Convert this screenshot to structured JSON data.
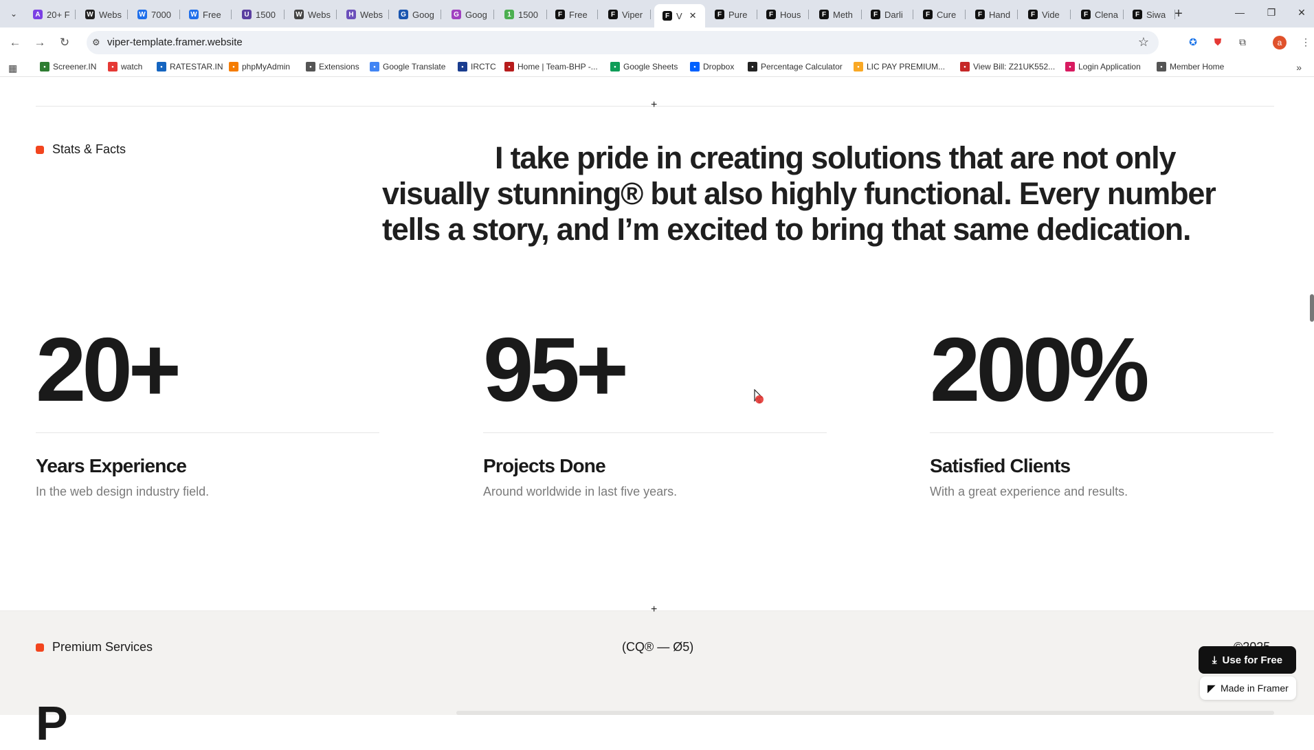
{
  "browser": {
    "tabs": [
      {
        "label": "20+ F",
        "color": "#7b3fe4",
        "glyph": "A"
      },
      {
        "label": "Webs",
        "color": "#222222",
        "glyph": "W"
      },
      {
        "label": "7000",
        "color": "#1f6feb",
        "glyph": "W"
      },
      {
        "label": "Free",
        "color": "#1f6feb",
        "glyph": "W"
      },
      {
        "label": "1500",
        "color": "#5b3fa0",
        "glyph": "U"
      },
      {
        "label": "Webs",
        "color": "#444444",
        "glyph": "W"
      },
      {
        "label": "Webs",
        "color": "#6b4fbb",
        "glyph": "H"
      },
      {
        "label": "Goog",
        "color": "#1a56b0",
        "glyph": "G"
      },
      {
        "label": "Goog",
        "color": "#a040c0",
        "glyph": "G"
      },
      {
        "label": "1500",
        "color": "#4caf50",
        "glyph": "1"
      },
      {
        "label": "Free",
        "color": "#111111",
        "glyph": "F"
      },
      {
        "label": "Viper",
        "color": "#111111",
        "glyph": "F"
      },
      {
        "label": "V",
        "color": "#111111",
        "glyph": "F"
      },
      {
        "label": "Pure",
        "color": "#111111",
        "glyph": "F"
      },
      {
        "label": "Hous",
        "color": "#111111",
        "glyph": "F"
      },
      {
        "label": "Meth",
        "color": "#111111",
        "glyph": "F"
      },
      {
        "label": "Darli",
        "color": "#111111",
        "glyph": "F"
      },
      {
        "label": "Cure",
        "color": "#111111",
        "glyph": "F"
      },
      {
        "label": "Hand",
        "color": "#111111",
        "glyph": "F"
      },
      {
        "label": "Vide",
        "color": "#111111",
        "glyph": "F"
      },
      {
        "label": "Clena",
        "color": "#111111",
        "glyph": "F"
      },
      {
        "label": "Siwa",
        "color": "#111111",
        "glyph": "F"
      }
    ],
    "url": "viper-template.framer.website",
    "bookmarks": [
      {
        "label": "Screener.IN",
        "color": "#2e7d32"
      },
      {
        "label": "watch",
        "color": "#e53935"
      },
      {
        "label": "RATESTAR.IN",
        "color": "#1565c0"
      },
      {
        "label": "phpMyAdmin",
        "color": "#f57c00"
      },
      {
        "label": "Extensions",
        "color": "#555555"
      },
      {
        "label": "Google Translate",
        "color": "#4285f4"
      },
      {
        "label": "IRCTC",
        "color": "#1a3d8f"
      },
      {
        "label": "Home | Team-BHP -...",
        "color": "#b71c1c"
      },
      {
        "label": "Google Sheets",
        "color": "#0f9d58"
      },
      {
        "label": "Dropbox",
        "color": "#0061fe"
      },
      {
        "label": "Percentage Calculator",
        "color": "#222222"
      },
      {
        "label": "LIC PAY PREMIUM...",
        "color": "#f9a825"
      },
      {
        "label": "View Bill: Z21UK552...",
        "color": "#c62828"
      },
      {
        "label": "Login Application",
        "color": "#d81b60"
      },
      {
        "label": "Member Home",
        "color": "#555555"
      }
    ]
  },
  "stats_section": {
    "tag": "Stats & Facts",
    "statement": "I take pride in creating solutions that are not only visually stunning® but also highly functional. Every number tells a story, and I’m excited to bring that same dedication.",
    "stats": [
      {
        "value": "20+",
        "title": "Years Experience",
        "desc": "In the web design industry field."
      },
      {
        "value": "95+",
        "title": "Projects Done",
        "desc": "Around worldwide in last five years."
      },
      {
        "value": "200%",
        "title": "Satisfied Clients",
        "desc": "With a great experience and results."
      }
    ]
  },
  "services_section": {
    "tag": "Premium Services",
    "code": "(CQ® — Ø5)",
    "year": "©2025",
    "big_letter": "P"
  },
  "framer_badges": {
    "use_for_free": "Use for Free",
    "made_in_framer": "Made in Framer"
  },
  "colors": {
    "accent": "#f2451e",
    "tabbar": "#dfe3eb",
    "band": "#f3f2f0"
  }
}
